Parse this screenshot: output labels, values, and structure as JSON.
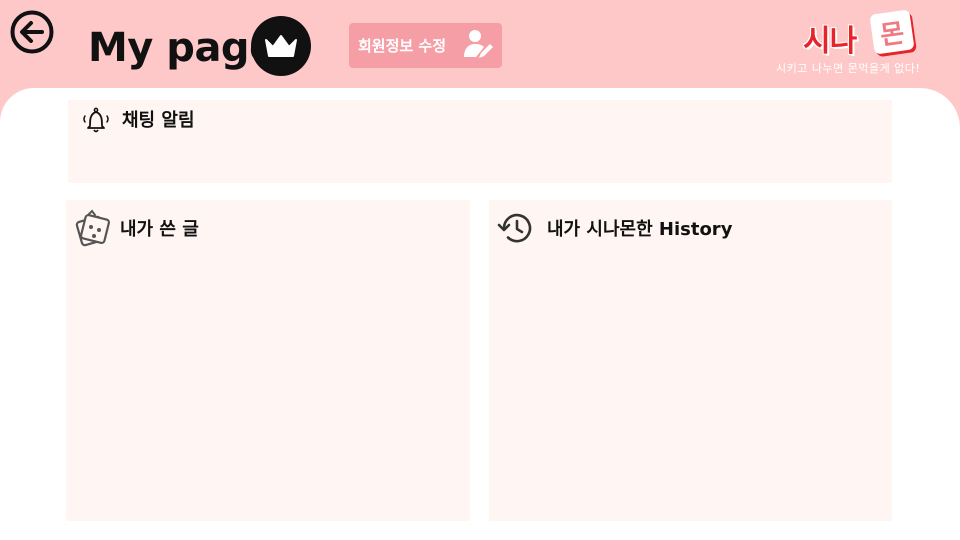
{
  "header": {
    "title": "My page",
    "edit_profile_label": "회원정보 수정",
    "brand": {
      "name": "시나",
      "badge": "몬",
      "tagline": "시키고 나누면 몬먹을게 없다!"
    }
  },
  "sections": {
    "notifications": {
      "title": "채팅 알림"
    },
    "my_posts": {
      "title": "내가 쓴 글"
    },
    "history": {
      "title": "내가 시나몬한 History"
    }
  },
  "colors": {
    "header_background": "#ffc8c8",
    "button_background": "#f59ea5",
    "card_background": "#fff5f2",
    "brand_red": "#e62429"
  },
  "icons": {
    "back": "back-arrow-icon",
    "crown": "crown-icon",
    "user_edit": "user-edit-icon",
    "bell": "bell-icon",
    "notes": "sticky-note-icon",
    "history": "history-icon"
  }
}
